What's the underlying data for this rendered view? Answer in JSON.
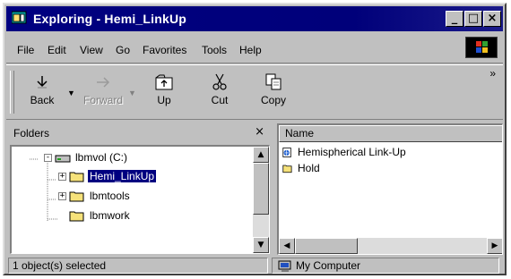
{
  "window": {
    "title": "Exploring - Hemi_LinkUp",
    "controls": {
      "minimize": "_",
      "maximize": "□",
      "close": "×"
    }
  },
  "menu": {
    "items": [
      "File",
      "Edit",
      "View",
      "Go",
      "Favorites",
      "Tools",
      "Help"
    ]
  },
  "toolbar": {
    "back_label": "Back",
    "forward_label": "Forward",
    "up_label": "Up",
    "cut_label": "Cut",
    "copy_label": "Copy",
    "more_glyph": "»"
  },
  "folders_pane": {
    "title": "Folders",
    "close_glyph": "×",
    "tree": {
      "drive": "lbmvol (C:)",
      "children": [
        "Hemi_LinkUp",
        "lbmtools",
        "lbmwork"
      ],
      "selected": "Hemi_LinkUp"
    }
  },
  "contents_pane": {
    "column_header": "Name",
    "items": [
      {
        "name": "Hemispherical Link-Up",
        "icon": "internet-shortcut-icon"
      },
      {
        "name": "Hold",
        "icon": "folder-icon"
      }
    ]
  },
  "statusbar": {
    "selection": "1 object(s) selected",
    "location": "My Computer"
  },
  "colors": {
    "titlebar": "#000080",
    "face": "#c0c0c0",
    "selection": "#000080",
    "folder": "#f6e27a"
  }
}
